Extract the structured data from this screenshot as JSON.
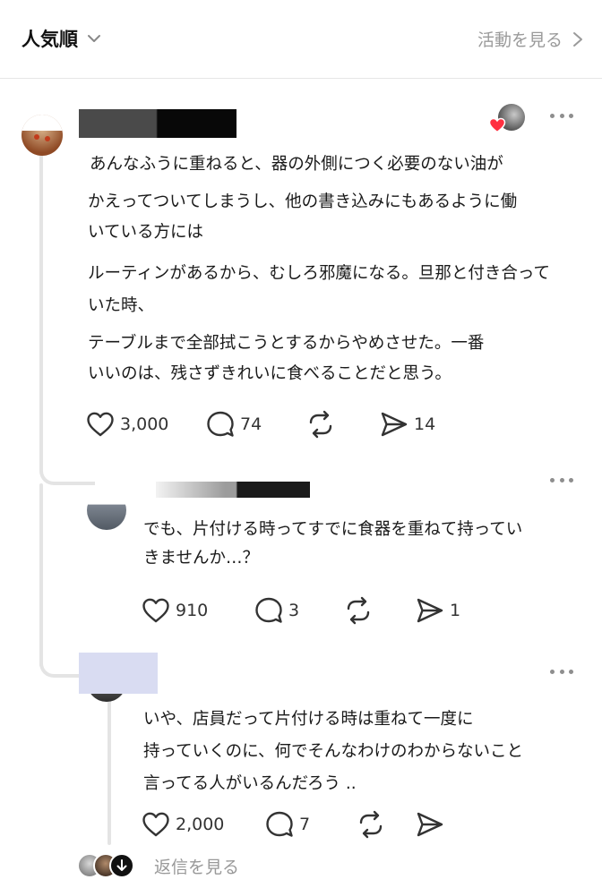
{
  "header": {
    "sort_label": "人気順",
    "activity_label": "活動を見る"
  },
  "posts": [
    {
      "lines": [
        "あんなふうに重ねると、器の外側につく必要のない油が",
        "かえってついてしまうし、他の書き込みにもあるように働",
        "いている方には",
        "ルーティンがあるから、むしろ邪魔になる。旦那と付き合って",
        "いた時、",
        "テーブルまで全部拭こうとするからやめさせた。一番",
        "いいのは、残さずきれいに食べることだと思う。"
      ],
      "likes": "3,000",
      "comments": "74",
      "reposts": "",
      "shares": "14"
    },
    {
      "lines": [
        "でも、片付ける時ってすでに食器を重ねて持ってい",
        "きませんか…？"
      ],
      "likes": "910",
      "comments": "3",
      "reposts": "",
      "shares": "1"
    },
    {
      "lines": [
        "いや、店員だって片付ける時は重ねて一度に",
        "持っていくのに、何でそんなわけのわからないこと",
        "言ってる人がいるんだろう .."
      ],
      "likes": "2,000",
      "comments": "7",
      "reposts": "",
      "shares": ""
    }
  ],
  "footer": {
    "view_replies_label": "返信を見る"
  },
  "colors": {
    "text": "#1a1a1a",
    "muted": "#999999",
    "thread_line": "#e4e4e4",
    "heart_badge": "#ff3040"
  },
  "icons": [
    "chevron-down-icon",
    "chevron-right-icon",
    "heart-icon",
    "comment-icon",
    "repost-icon",
    "share-icon",
    "more-icon",
    "arrow-down-icon"
  ]
}
